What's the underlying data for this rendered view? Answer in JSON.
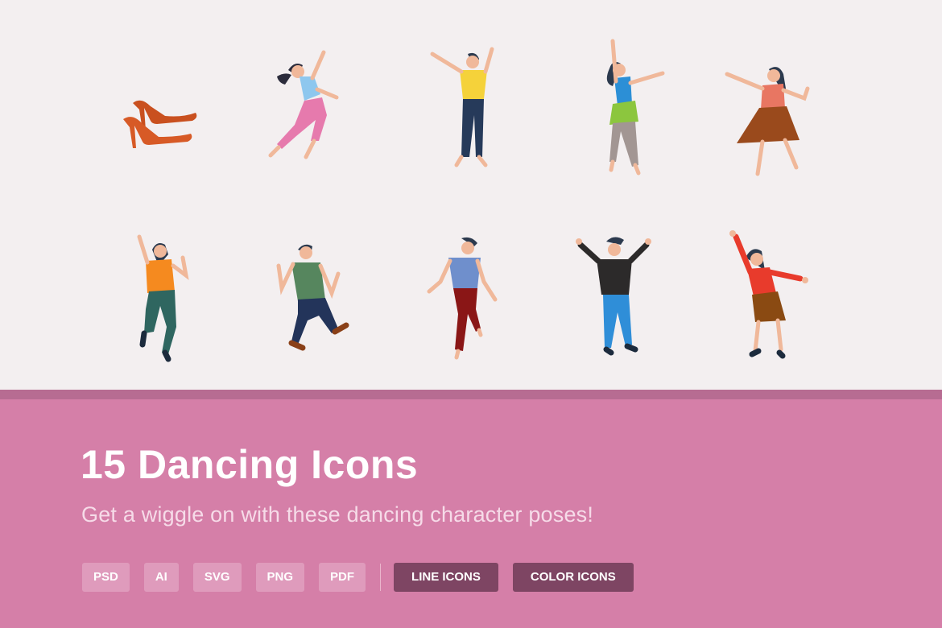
{
  "banner": {
    "title": "15 Dancing Icons",
    "subtitle": "Get a wiggle on with these dancing character poses!",
    "formats": [
      "PSD",
      "AI",
      "SVG",
      "PNG",
      "PDF"
    ],
    "styles": [
      "LINE ICONS",
      "COLOR ICONS"
    ]
  },
  "icons": [
    {
      "name": "high-heels-icon"
    },
    {
      "name": "dancer-pink-pants-icon"
    },
    {
      "name": "dancer-yellow-shirt-icon"
    },
    {
      "name": "dancer-green-skirt-icon"
    },
    {
      "name": "dancer-brown-skirt-icon"
    },
    {
      "name": "dancer-orange-shirt-icon"
    },
    {
      "name": "dancer-green-shirt-icon"
    },
    {
      "name": "dancer-blue-shirt-icon"
    },
    {
      "name": "dancer-black-shirt-icon"
    },
    {
      "name": "dancer-red-top-icon"
    }
  ],
  "colors": {
    "background": "#f3eff0",
    "banner": "#d57fa8",
    "band": "#b76c92",
    "tag": "#df9bbc",
    "tag_dark": "#7e4563"
  }
}
